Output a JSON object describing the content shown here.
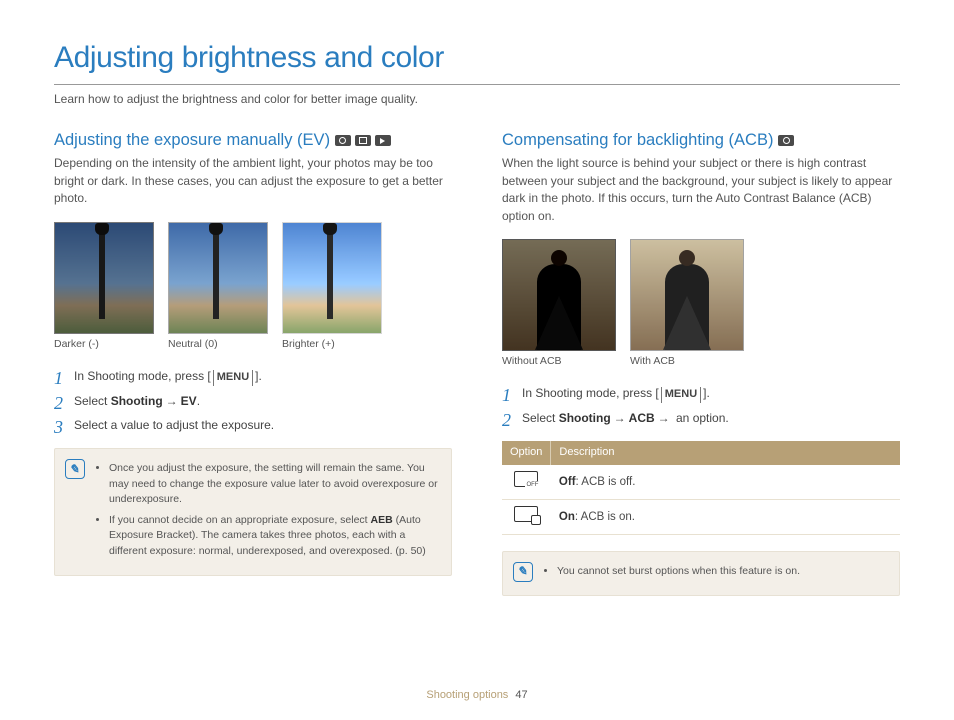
{
  "page": {
    "title": "Adjusting brightness and color",
    "subtitle": "Learn how to adjust the brightness and color for better image quality.",
    "footer_section": "Shooting options",
    "page_number": "47"
  },
  "left": {
    "heading": "Adjusting the exposure manually (EV)",
    "body": "Depending on the intensity of the ambient light, your photos may be too bright or dark. In these cases, you can adjust the exposure to get a better photo.",
    "captions": {
      "c1": "Darker (-)",
      "c2": "Neutral (0)",
      "c3": "Brighter (+)"
    },
    "steps": {
      "s1_pre": "In Shooting mode, press [",
      "s1_key": "MENU",
      "s1_post": "].",
      "s2_pre": "Select ",
      "s2_b1": "Shooting",
      "s2_arrow": "→",
      "s2_b2": "EV",
      "s2_post": ".",
      "s3": "Select a value to adjust the exposure."
    },
    "notes": {
      "n1": "Once you adjust the exposure, the setting will remain the same. You may need to change the exposure value later to avoid overexposure or underexposure.",
      "n2_pre": "If you cannot decide on an appropriate exposure, select ",
      "n2_b": "AEB",
      "n2_post": " (Auto Exposure Bracket). The camera takes three photos, each with a different exposure: normal, underexposed, and overexposed. (p. 50)"
    }
  },
  "right": {
    "heading": "Compensating for backlighting (ACB)",
    "body": "When the light source is behind your subject or there is high contrast between your subject and the background, your subject is likely to appear dark in the photo. If this occurs, turn the Auto Contrast Balance (ACB) option on.",
    "captions": {
      "c1": "Without ACB",
      "c2": "With ACB"
    },
    "steps": {
      "s1_pre": "In Shooting mode, press [",
      "s1_key": "MENU",
      "s1_post": "].",
      "s2_pre": "Select ",
      "s2_b1": "Shooting",
      "s2_arrow1": "→",
      "s2_b2": "ACB",
      "s2_arrow2": "→",
      "s2_post": " an option."
    },
    "table": {
      "h1": "Option",
      "h2": "Description",
      "r1_b": "Off",
      "r1_t": ": ACB is off.",
      "r2_b": "On",
      "r2_t": ": ACB is on."
    },
    "note": "You cannot set burst options when this feature is on."
  }
}
